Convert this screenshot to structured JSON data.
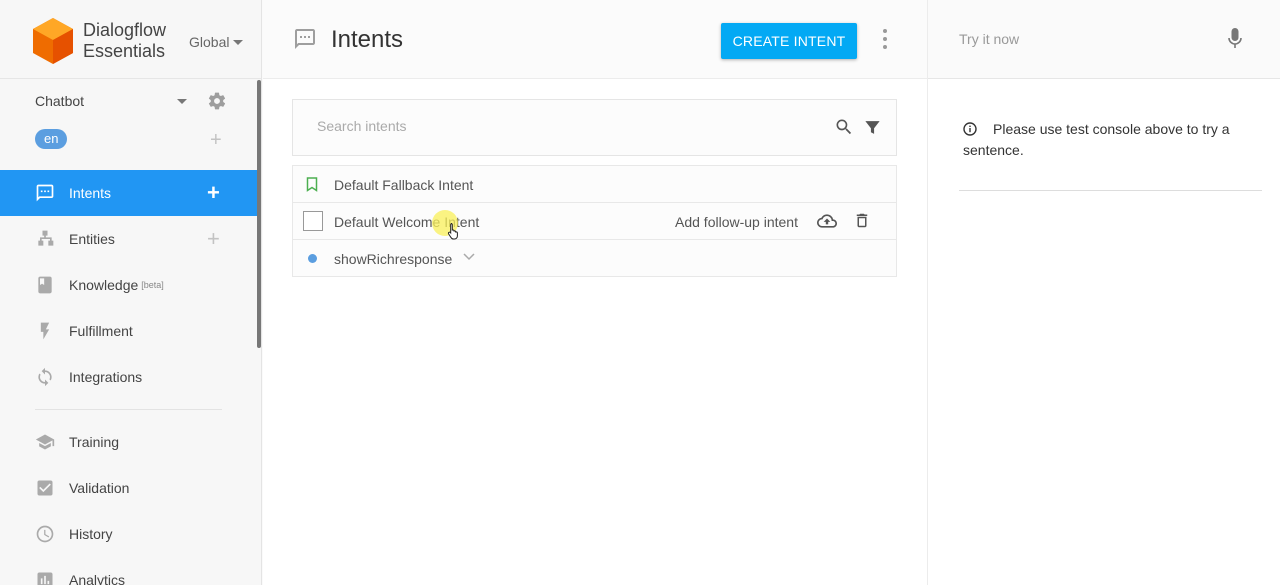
{
  "brand": {
    "line1": "Dialogflow",
    "line2": "Essentials",
    "region": "Global"
  },
  "agent": {
    "name": "Chatbot",
    "language": "en"
  },
  "nav": {
    "intents": "Intents",
    "entities": "Entities",
    "knowledge": "Knowledge",
    "knowledge_badge": "[beta]",
    "fulfillment": "Fulfillment",
    "integrations": "Integrations",
    "training": "Training",
    "validation": "Validation",
    "history": "History",
    "analytics": "Analytics"
  },
  "header": {
    "title": "Intents",
    "create_label": "CREATE INTENT"
  },
  "search": {
    "placeholder": "Search intents"
  },
  "intents": {
    "row1": "Default Fallback Intent",
    "row2": "Default Welcome Intent",
    "row2_followup": "Add follow-up intent",
    "row3": "showRichresponse"
  },
  "console": {
    "placeholder": "Try it now",
    "info": "Please use test console above to try a sentence."
  },
  "colors": {
    "accent": "#2196f3",
    "button": "#03a9f4",
    "logo": "#ef6c00"
  }
}
